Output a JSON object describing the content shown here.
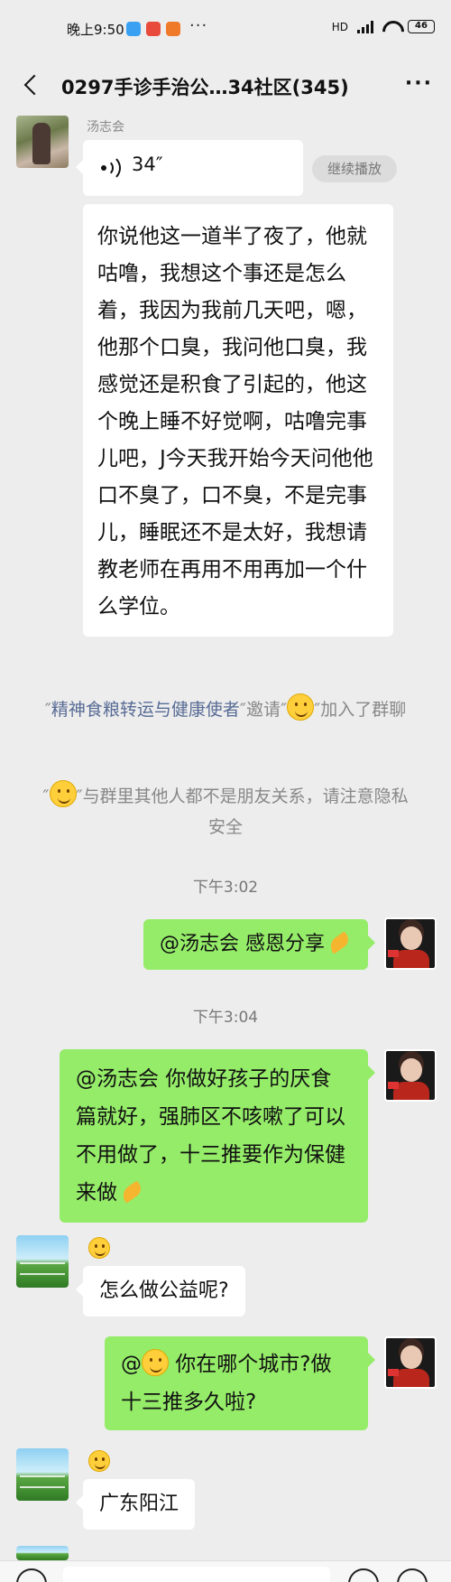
{
  "status_bar": {
    "time": "晚上9:50",
    "more_dots": "···",
    "network": "HD",
    "battery": "46"
  },
  "header": {
    "title": "0297手诊手治公…34社区(345)",
    "more": "···"
  },
  "messages": {
    "voice": {
      "sender": "汤志会",
      "duration": "34″",
      "continue_label": "继续播放",
      "transcript": "你说他这一道半了夜了，他就咕噜，我想这个事还是怎么着，我因为我前几天吧，嗯，他那个口臭，我问他口臭，我感觉还是积食了引起的，他这个晚上睡不好觉啊，咕噜完事儿吧，J今天我开始今天问他他口不臭了，口不臭，不是完事儿，睡眠还不是太好，我想请教老师在再用不用再加一个什么学位。"
    },
    "system1": {
      "q1": "″",
      "name": "精神食粮转运与健康使者",
      "q2": "″邀请″",
      "q3": "″加入了群聊"
    },
    "system2": {
      "q1": "″",
      "rest": "″与群里其他人都不是朋友关系，请注意隐私安全"
    },
    "time1": "下午3:02",
    "reply1": "@汤志会  感恩分享",
    "time2": "下午3:04",
    "reply2": "@汤志会  你做好孩子的厌食篇就好，强肺区不咳嗽了可以不用做了，十三推要作为保健来做",
    "user_msg1": "怎么做公益呢?",
    "reply3_prefix": "@",
    "reply3_text": " 你在哪个城市?做十三推多久啦?",
    "user_msg2": "广东阳江"
  },
  "colors": {
    "background": "#ededed",
    "green_bubble": "#95ec69",
    "white_bubble": "#ffffff",
    "link": "#576b95",
    "system_text": "#888888"
  },
  "icons": [
    "back-arrow-icon",
    "more-icon",
    "voice-wave-icon",
    "smile-emoji-icon",
    "pray-hands-icon"
  ]
}
